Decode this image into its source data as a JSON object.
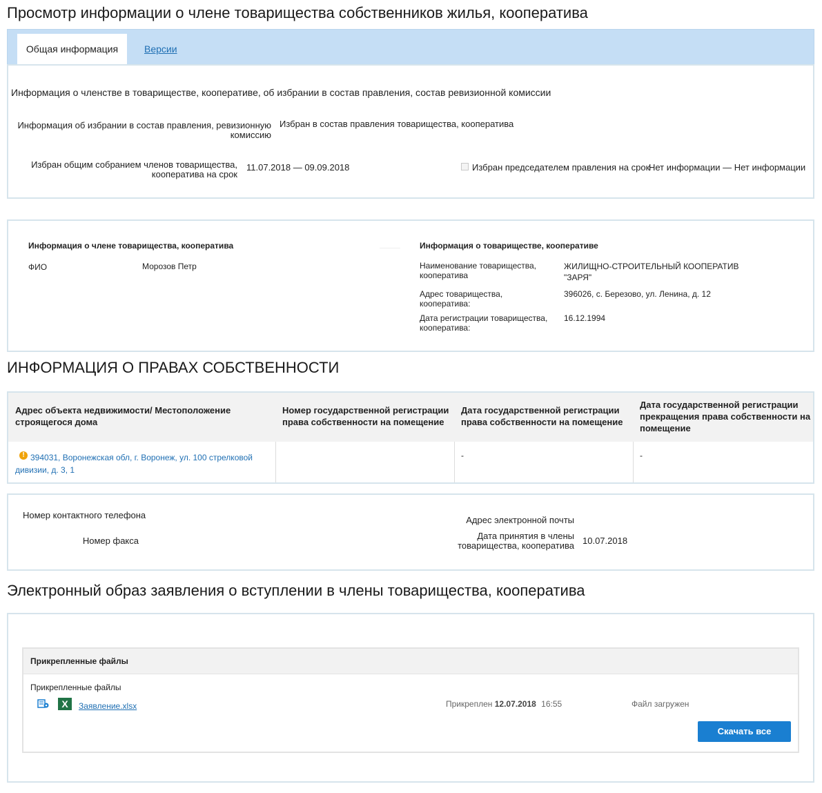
{
  "page": {
    "title": "Просмотр информации о члене товарищества собственников жилья, кооператива"
  },
  "tabs": [
    {
      "label": "Общая информация",
      "active": true
    },
    {
      "label": "Версии",
      "active": false
    }
  ],
  "membership": {
    "heading": "Информация о членстве в товариществе, кооперативе, об избрании в состав правления, состав ревизионной комиссии",
    "election_info_label_1": "Информация об избрании в состав правления, ревизионную",
    "election_info_label_2": "комиссию",
    "election_info_value": "Избран в состав правления товарищества, кооператива",
    "elected_term_label_1": "Избран общим собранием членов товарищества,",
    "elected_term_label_2": "кооператива на срок",
    "elected_term_value": "11.07.2018 — 09.09.2018",
    "chairman_checkbox_label": "Избран председателем правления на срок",
    "chairman_checked": false,
    "chairman_term_value": "Нет информации — Нет информации"
  },
  "member": {
    "heading": "Информация о члене товарищества, кооператива",
    "fio_label": "ФИО",
    "fio_value": "Морозов Петр"
  },
  "partnership": {
    "heading": "Информация о товариществе, кооперативе",
    "name_label_1": "Наименование товарищества,",
    "name_label_2": "кооператива",
    "name_value_1": "ЖИЛИЩНО-СТРОИТЕЛЬНЫЙ КООПЕРАТИВ",
    "name_value_2": "\"ЗАРЯ\"",
    "address_label_1": "Адрес товарищества,",
    "address_label_2": "кооператива:",
    "address_value": "396026, с. Березово, ул. Ленина, д. 12",
    "regdate_label_1": "Дата регистрации товарищества,",
    "regdate_label_2": "кооператива:",
    "regdate_value": "16.12.1994"
  },
  "ownership": {
    "heading": "ИНФОРМАЦИЯ О ПРАВАХ СОБСТВЕННОСТИ",
    "columns": [
      {
        "l1": "Адрес объекта недвижимости/ Местоположение",
        "l2": "строящегося дома",
        "l3": ""
      },
      {
        "l1": "Номер государственной регистрации",
        "l2": "права собственности на помещение",
        "l3": ""
      },
      {
        "l1": "Дата государственной регистрации",
        "l2": "права собственности на помещение",
        "l3": ""
      },
      {
        "l1": "Дата государственной регистрации",
        "l2": "прекращения права собственности на",
        "l3": "помещение"
      }
    ],
    "row": {
      "address_1": "394031, Воронежская обл, г. Воронеж, ул. 100 стрелковой",
      "address_2": "дивизии, д. 3, 1",
      "reg_number": "",
      "reg_date": "-",
      "end_date": "-"
    }
  },
  "contacts": {
    "phone_label": "Номер контактного телефона",
    "fax_label": "Номер факса",
    "email_label": "Адрес электронной почты",
    "join_date_label_1": "Дата принятия в члены",
    "join_date_label_2": "товарищества, кооператива",
    "join_date_value": "10.07.2018"
  },
  "application": {
    "heading": "Электронный образ заявления о вступлении в члены товарищества, кооператива",
    "files_header": "Прикрепленные файлы",
    "files_sublabel": "Прикрепленные файлы",
    "file_name": "Заявление.xlsx",
    "file_icon_letter": "X",
    "attached_prefix": "Прикреплен",
    "attached_date": "12.07.2018",
    "attached_time": "16:55",
    "file_status": "Файл загружен",
    "download_all_label": "Скачать все"
  },
  "colors": {
    "accent": "#1a7fd1",
    "link": "#1f6fb3",
    "tabbar": "#c5def5",
    "border": "#d6e4ec",
    "warning": "#f0a30a",
    "excel": "#217346"
  }
}
